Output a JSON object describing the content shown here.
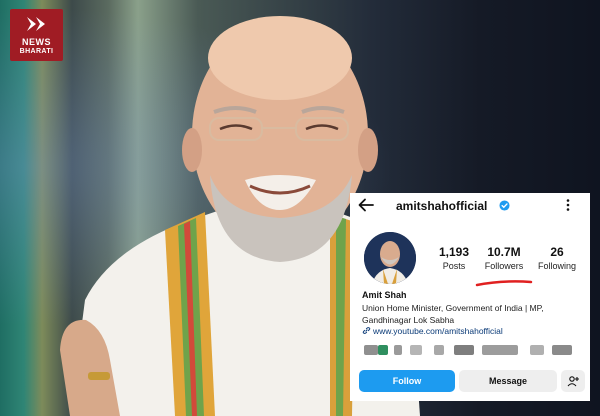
{
  "logo": {
    "line1": "NEWS",
    "line2": "BHARATI"
  },
  "profile": {
    "username": "amitshahofficial",
    "name": "Amit Shah",
    "bio": "Union Home Minister, Government of India | MP, Gandhinagar Lok Sabha",
    "link": "www.youtube.com/amitshahofficial"
  },
  "stats": [
    {
      "value": "1,193",
      "label": "Posts"
    },
    {
      "value": "10.7M",
      "label": "Followers"
    },
    {
      "value": "26",
      "label": "Following"
    }
  ],
  "buttons": {
    "follow": "Follow",
    "message": "Message"
  },
  "colors": {
    "follow_button": "#1d9bf0",
    "annotation_underline": "#e02020",
    "logo_bg": "#a01c24"
  },
  "icons": [
    "back-arrow-icon",
    "verified-badge-icon",
    "more-options-icon",
    "link-icon",
    "add-user-icon"
  ]
}
